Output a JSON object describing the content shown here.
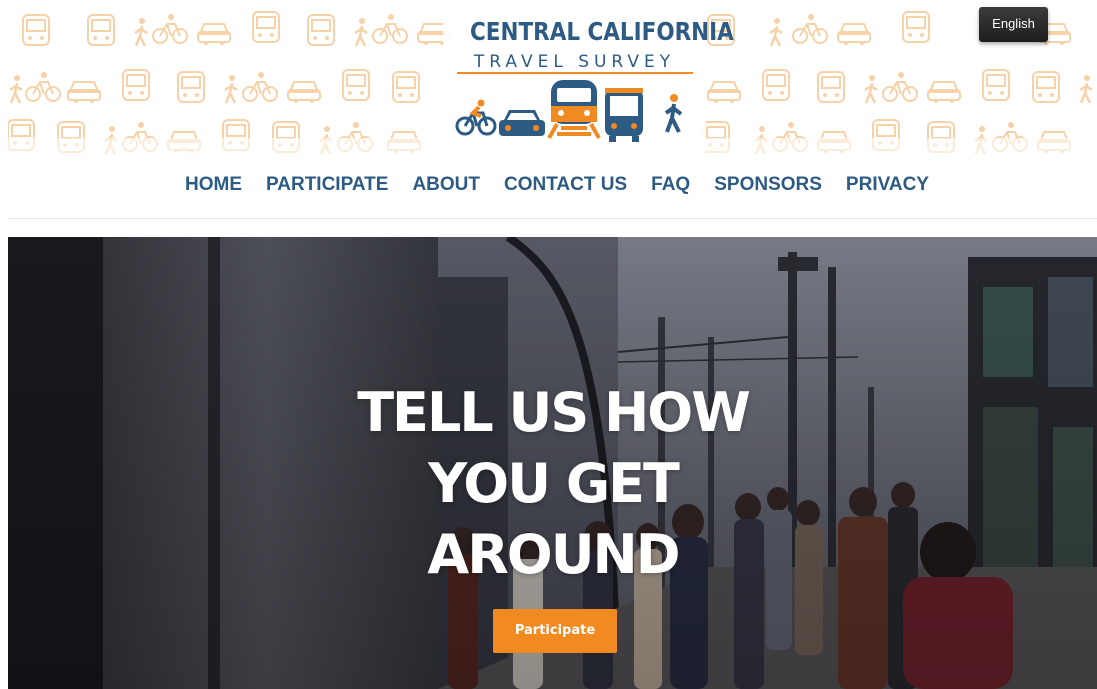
{
  "brand": {
    "title": "CENTRAL CALIFORNIA",
    "subtitle": "TRAVEL SURVEY",
    "colors": {
      "primary": "#2e5b84",
      "accent": "#f28a22",
      "pattern": "#f7d2a8"
    }
  },
  "language": {
    "label": "English"
  },
  "nav": {
    "items": [
      {
        "label": "HOME"
      },
      {
        "label": "PARTICIPATE"
      },
      {
        "label": "ABOUT"
      },
      {
        "label": "CONTACT US"
      },
      {
        "label": "FAQ"
      },
      {
        "label": "SPONSORS"
      },
      {
        "label": "PRIVACY"
      }
    ]
  },
  "hero": {
    "line1": "TELL US HOW",
    "line2": "YOU GET",
    "line3": "AROUND",
    "cta_label": "Participate"
  },
  "icons": [
    "bicycle-icon",
    "car-icon",
    "train-icon",
    "bus-icon",
    "walking-icon"
  ]
}
